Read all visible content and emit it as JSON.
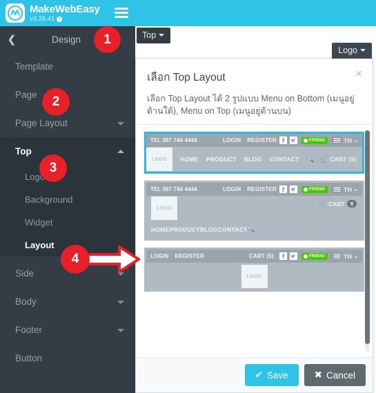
{
  "brand": {
    "name": "MakeWebEasy",
    "version": "v3.25.41",
    "info_icon": "info-icon",
    "logo_icon": "makewebeasy-logo-icon",
    "menu_icon": "hamburger-menu-icon",
    "accent": "#2fc3e8"
  },
  "sidebar": {
    "back_icon": "chevron-left-icon",
    "title": "Design",
    "items": [
      {
        "label": "Template",
        "caret": false,
        "active": false
      },
      {
        "label": "Page",
        "caret": false,
        "active": false
      },
      {
        "label": "Page Layout",
        "caret": "down",
        "active": false
      },
      {
        "label": "Top",
        "caret": "up",
        "active": true
      },
      {
        "label": "Side",
        "caret": "down",
        "active": false
      },
      {
        "label": "Body",
        "caret": "down",
        "active": false
      },
      {
        "label": "Footer",
        "caret": "down",
        "active": false
      },
      {
        "label": "Button",
        "caret": false,
        "active": false
      }
    ],
    "top_subitems": [
      {
        "label": "Logo",
        "active": false
      },
      {
        "label": "Background",
        "active": false
      },
      {
        "label": "Widget",
        "active": false
      },
      {
        "label": "Layout",
        "active": true
      }
    ]
  },
  "callouts": [
    {
      "number": "1",
      "target": "design-header"
    },
    {
      "number": "2",
      "target": "page-item"
    },
    {
      "number": "3",
      "target": "top-item"
    },
    {
      "number": "4",
      "target": "layout-subitem"
    }
  ],
  "annotation": {
    "arrow_icon": "right-arrow-annotation",
    "color": "#e8202a"
  },
  "workspace": {
    "tab_top": "Top",
    "tab_logo": "Logo",
    "caret_icon": "caret-down-icon"
  },
  "modal": {
    "title": "เลือก Top Layout",
    "close_icon": "close-icon",
    "description": "เลือก Top Layout ได้ 2 รูปแบบ Menu on Bottom (เมนูอยู่ด้านใต้), Menu on Top (เมนูอยู่ด้านบน)",
    "save_label": "Save",
    "cancel_label": "Cancel",
    "save_icon": "check-icon",
    "cancel_icon": "x-icon",
    "save_color": "#2fc3e8",
    "cancel_color": "#5f6a6f",
    "selected_border_color": "#29bbe3",
    "scrollbar": "vertical-scrollbar"
  },
  "previews": {
    "common": {
      "tel": "TEL 087 744 4444",
      "login": "LOGIN",
      "register": "REGISTER",
      "facebook_icon": "facebook-icon",
      "twitter_icon": "twitter-icon",
      "friend_badge": "FRIEND",
      "friend_color": "#43c900",
      "flag_icon": "thai-flag-icon",
      "lang": "TH",
      "lang_caret": "⌄",
      "logo_placeholder": "LOGO",
      "search_icon": "search-icon",
      "cart_icon": "cart-icon"
    },
    "cards": [
      {
        "name": "menu-on-bottom-layout",
        "selected": true,
        "menu": [
          "HOME",
          "PRODUCT",
          "BLOG",
          "CONTACT"
        ],
        "cart_label": "CART (5)"
      },
      {
        "name": "menu-on-bottom-stacked-layout",
        "selected": false,
        "menu": [
          "HOME",
          "PRODUCT",
          "BLOG",
          "CONTACT"
        ],
        "cart_label": "CART",
        "cart_count": "5"
      },
      {
        "name": "menu-on-top-centered-logo-layout",
        "selected": false,
        "cart_label": "CART (5)"
      }
    ]
  }
}
